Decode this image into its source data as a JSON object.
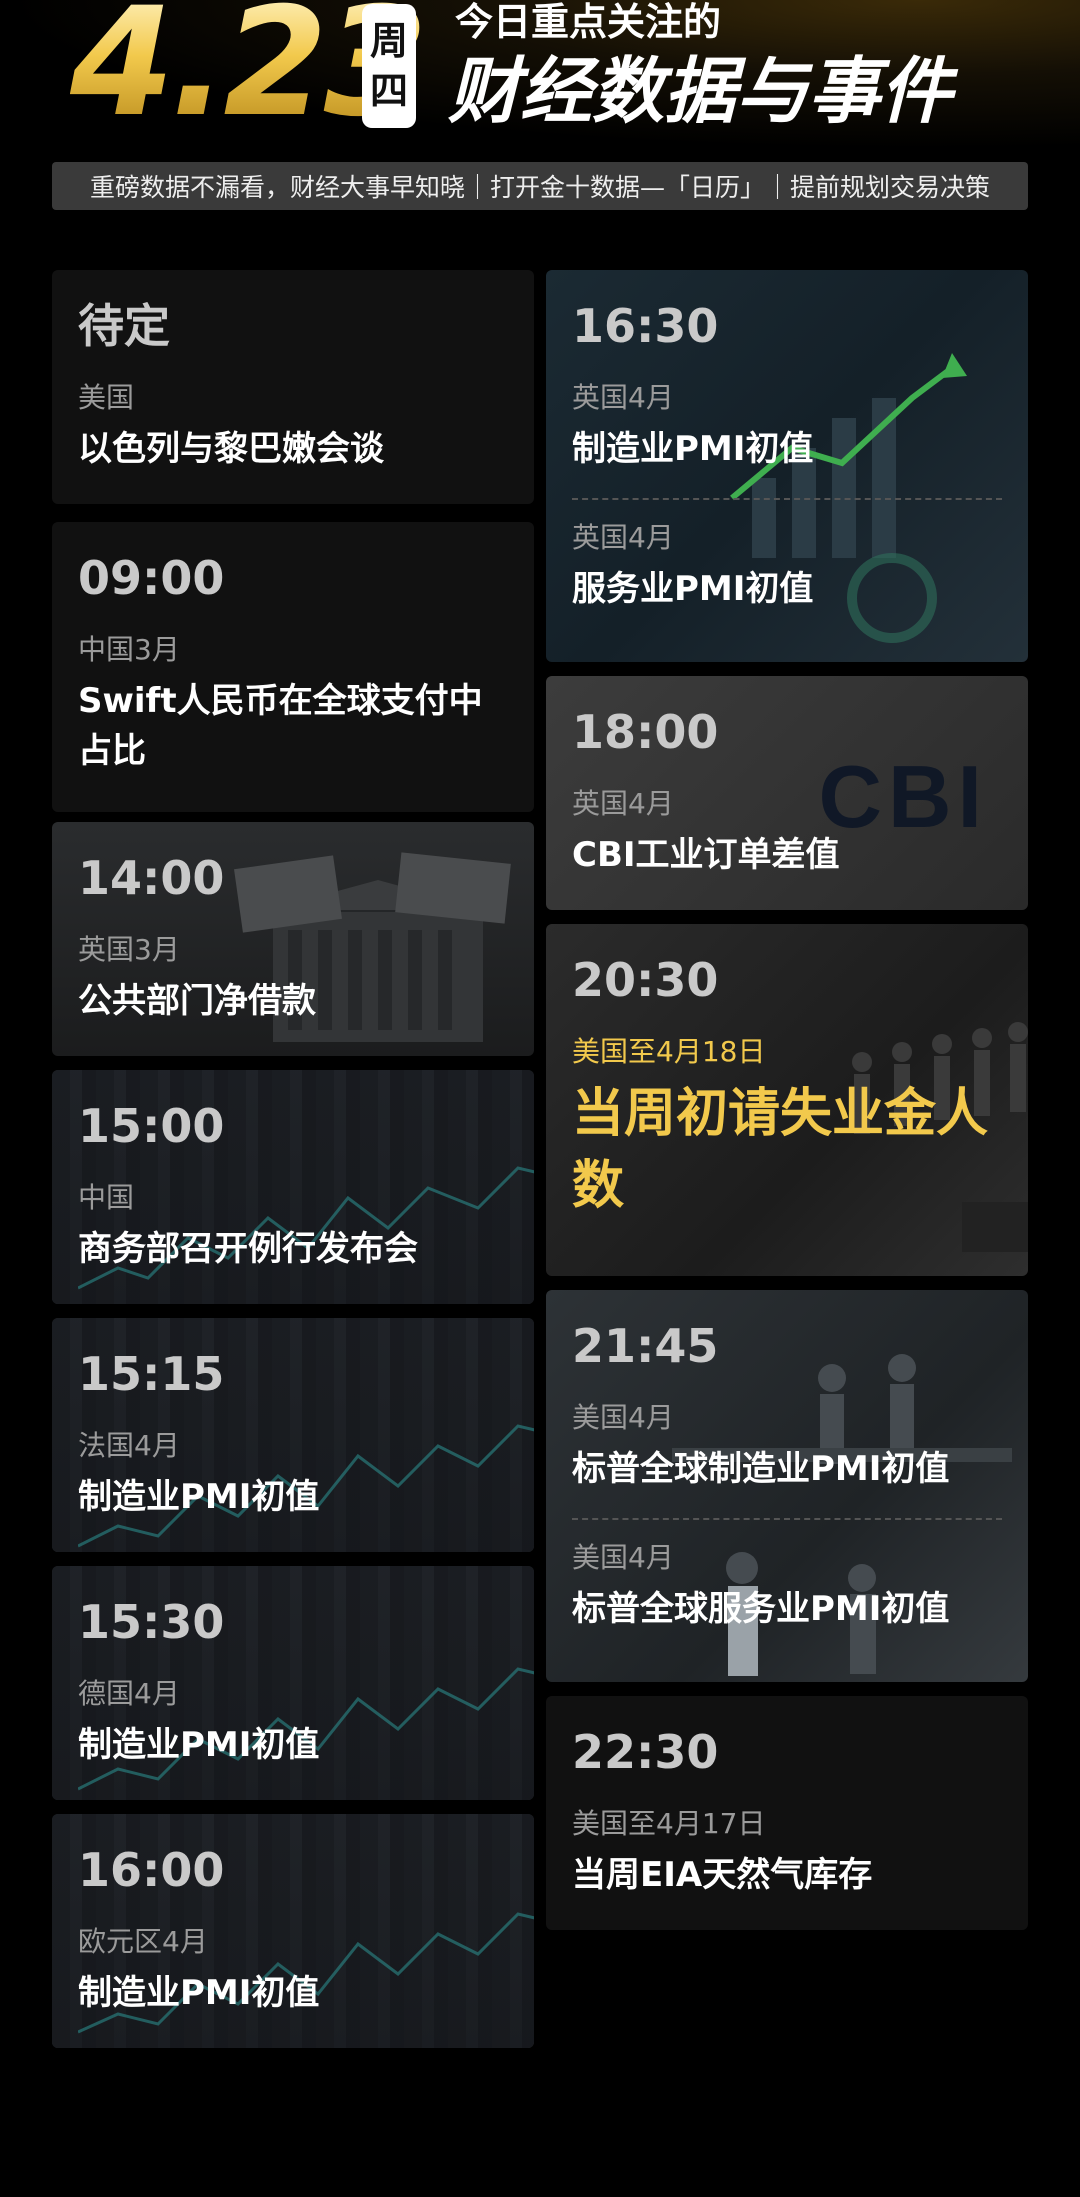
{
  "header": {
    "date": "4.23",
    "weekday_top": "周",
    "weekday_bottom": "四",
    "headline_small": "今日重点关注的",
    "headline_big": "财经数据与事件",
    "subtitle": "重磅数据不漏看，财经大事早知晓｜打开金十数据—「日历」｜提前规划交易决策"
  },
  "left_cards": [
    {
      "time": "待定",
      "region": "美国",
      "event": "以色列与黎巴嫩会谈"
    },
    {
      "time": "09:00",
      "region": "中国3月",
      "event": "Swift人民币在全球支付中占比"
    },
    {
      "time": "14:00",
      "region": "英国3月",
      "event": "公共部门净借款"
    },
    {
      "time": "15:00",
      "region": "中国",
      "event": "商务部召开例行发布会"
    },
    {
      "time": "15:15",
      "region": "法国4月",
      "event": "制造业PMI初值"
    },
    {
      "time": "15:30",
      "region": "德国4月",
      "event": "制造业PMI初值"
    },
    {
      "time": "16:00",
      "region": "欧元区4月",
      "event": "制造业PMI初值"
    }
  ],
  "right_cards": [
    {
      "time": "16:30",
      "items": [
        {
          "region": "英国4月",
          "event": "制造业PMI初值"
        },
        {
          "region": "英国4月",
          "event": "服务业PMI初值"
        }
      ]
    },
    {
      "time": "18:00",
      "logo": "CBI",
      "region": "英国4月",
      "event": "CBI工业订单差值"
    },
    {
      "time": "20:30",
      "region": "美国至4月18日",
      "event": "当周初请失业金人数",
      "highlight": true
    },
    {
      "time": "21:45",
      "items": [
        {
          "region": "美国4月",
          "event": "标普全球制造业PMI初值"
        },
        {
          "region": "美国4月",
          "event": "标普全球服务业PMI初值"
        }
      ]
    },
    {
      "time": "22:30",
      "region": "美国至4月17日",
      "event": "当周EIA天然气库存"
    }
  ],
  "colors": {
    "accent": "#f2c94c",
    "background": "#000000",
    "card": "#111111"
  }
}
